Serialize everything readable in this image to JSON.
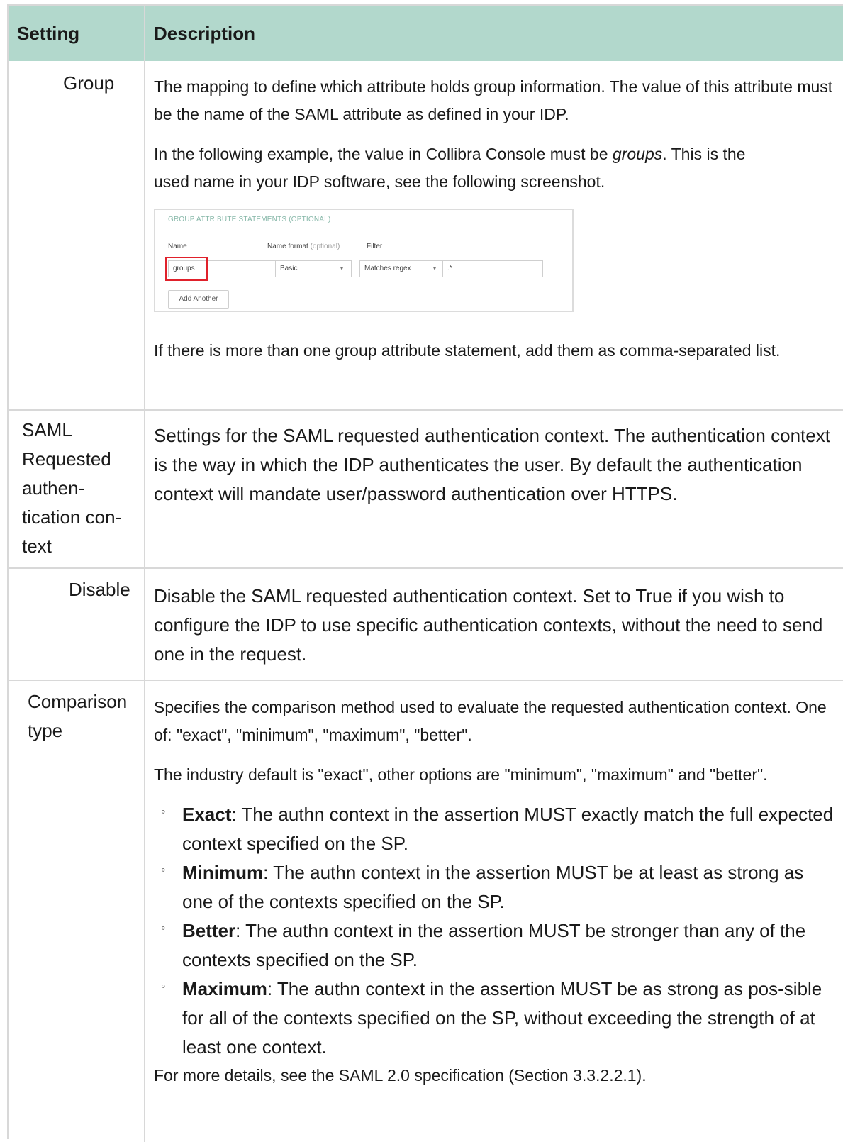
{
  "table": {
    "headers": {
      "setting": "Setting",
      "description": "Description"
    },
    "rows": [
      {
        "setting": "Group",
        "paragraphs": [
          "The mapping to define which attribute holds group information. The value of this attribute must be the name of the SAML attribute as defined in your IDP.",
          "used name in your IDP software, see the following screenshot.",
          "If there is more than one group attribute statement, add them as comma-separated list."
        ],
        "example_before": "In the following example, the value in Collibra Console must be ",
        "example_em": "groups",
        "example_after": ". This is the"
      },
      {
        "setting": "SAML Requested authen-tication con-text",
        "setting_lines": [
          "SAML",
          "Requested",
          "authen-",
          "tication con-",
          "text"
        ],
        "paragraph": "Settings for the SAML requested authentication context. The authentication context is the way in which the IDP authenticates the user. By default the authentication context will mandate user/password authentication over HTTPS."
      },
      {
        "setting": "Disable",
        "paragraph": "Disable the SAML requested authentication context. Set to True if you wish to configure the IDP to use specific authentication contexts, without the need to send one in the request."
      },
      {
        "setting_lines": [
          "Comparison",
          "type"
        ],
        "paragraphs": [
          "Specifies the comparison method used to evaluate the requested authentication context. One of: \"exact\", \"minimum\", \"maximum\", \"better\".",
          "The industry default is \"exact\", other options are \"minimum\", \"maximum\" and \"better\"."
        ],
        "options": [
          {
            "term": "Exact",
            "text": ": The authn context in the assertion MUST exactly match the full expected context specified on the SP."
          },
          {
            "term": "Minimum",
            "text": ": The authn context in the assertion MUST be at least as strong as one of the contexts specified on the SP."
          },
          {
            "term": "Better",
            "text": ": The authn context in the assertion MUST be stronger than any of the contexts specified on the SP."
          },
          {
            "term": "Maximum",
            "text": ": The authn context in the assertion MUST be as strong as pos-sible for all of the contexts specified on the SP, without exceeding the strength of at least one context."
          }
        ],
        "footer": "For more details, see the SAML 2.0 specification (Section 3.3.2.2.1)."
      }
    ]
  },
  "screenshot": {
    "header": "GROUP ATTRIBUTE STATEMENTS (OPTIONAL)",
    "name_label": "Name",
    "format_label": "Name format",
    "format_optional": "(optional)",
    "filter_label": "Filter",
    "name_value": "groups",
    "format_value": "Basic",
    "filter_value": "Matches regex",
    "regex_value": ".*",
    "add_button": "Add Another",
    "arrow": "▾",
    "highlight_color": "#e0212b"
  },
  "bullet": "◦",
  "colors": {
    "header_bg": "#b2d8cc",
    "border": "#d8d8d8"
  }
}
